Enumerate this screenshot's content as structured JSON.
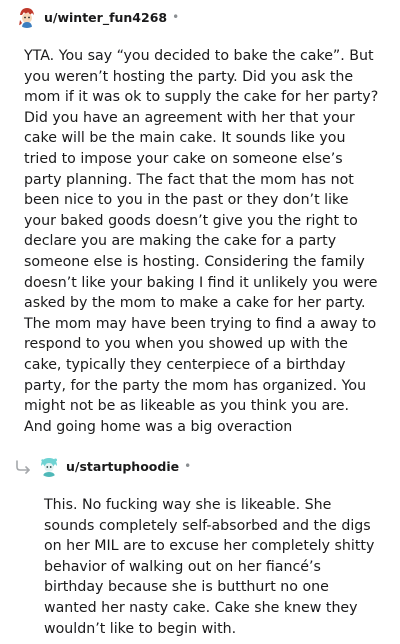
{
  "comments": [
    {
      "username": "u/winter_fun4268",
      "separator": "•",
      "avatar_icon": "snoo-avatar-red-hair-icon",
      "body": "YTA. You say “you decided to bake the cake”. But you weren’t hosting the party. Did you ask the mom if it was ok to supply the cake for her party? Did you have an agreement with her that your cake will be the main cake. It sounds like you tried to impose your cake on someone else’s party planning. The fact that the mom has not been nice to you in the past or they don’t like your baked goods doesn’t give you the right to declare you are making the cake for a party someone else is hosting. Considering the family doesn’t like your baking I find it unlikely you were asked by the mom to make a cake for her party. The mom may have been trying to find a away to respond to you when you showed up with the cake, typically they centerpiece of a birthday party, for the party the mom has organized. You might not be as likeable as you think you are. And going home was a big overaction"
    },
    {
      "username": "u/startuphoodie",
      "separator": "•",
      "avatar_icon": "snoo-avatar-teal-icon",
      "reply_icon": "reply-arrow-icon",
      "body": "This. No fucking way she is likeable. She sounds completely self-absorbed and the digs on her MIL are to excuse her completely shitty behavior of walking out on her fiancé’s birthday because she is butthurt no one wanted her nasty cake. Cake she knew they wouldn’t like to begin with."
    }
  ]
}
